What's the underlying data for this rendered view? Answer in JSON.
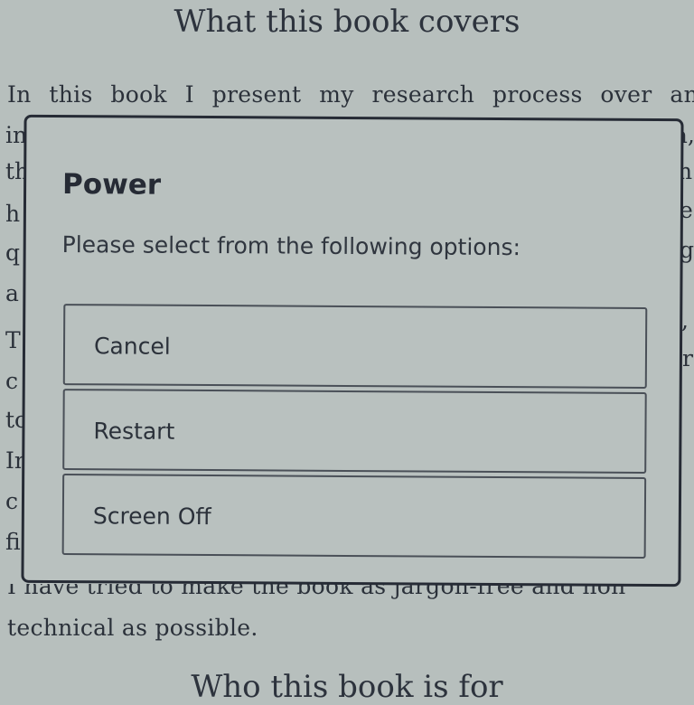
{
  "book": {
    "heading_top": "What this book covers",
    "first_line_words": [
      "In",
      "this",
      "book",
      "I",
      "present",
      "my",
      "research",
      "process",
      "over",
      "an"
    ],
    "left_fragments": [
      "in",
      "th",
      "h",
      "q",
      "a",
      "T",
      "c",
      "to",
      "In",
      "c",
      "fi"
    ],
    "right_fragments": [
      "a,",
      "n",
      "e",
      "g",
      ",",
      "r"
    ],
    "line_below_dialog": "I have tried to make the book as jargon-free and non",
    "last_line": "technical as possible.",
    "heading_bottom": "Who this book is for"
  },
  "dialog": {
    "title": "Power",
    "message": "Please select from the following options:",
    "options": [
      {
        "label": "Cancel"
      },
      {
        "label": "Restart"
      },
      {
        "label": "Screen Off"
      }
    ]
  },
  "colors": {
    "screen_bg": "#b7bfbd",
    "ink": "#2b313a",
    "dialog_border": "#262b35"
  }
}
